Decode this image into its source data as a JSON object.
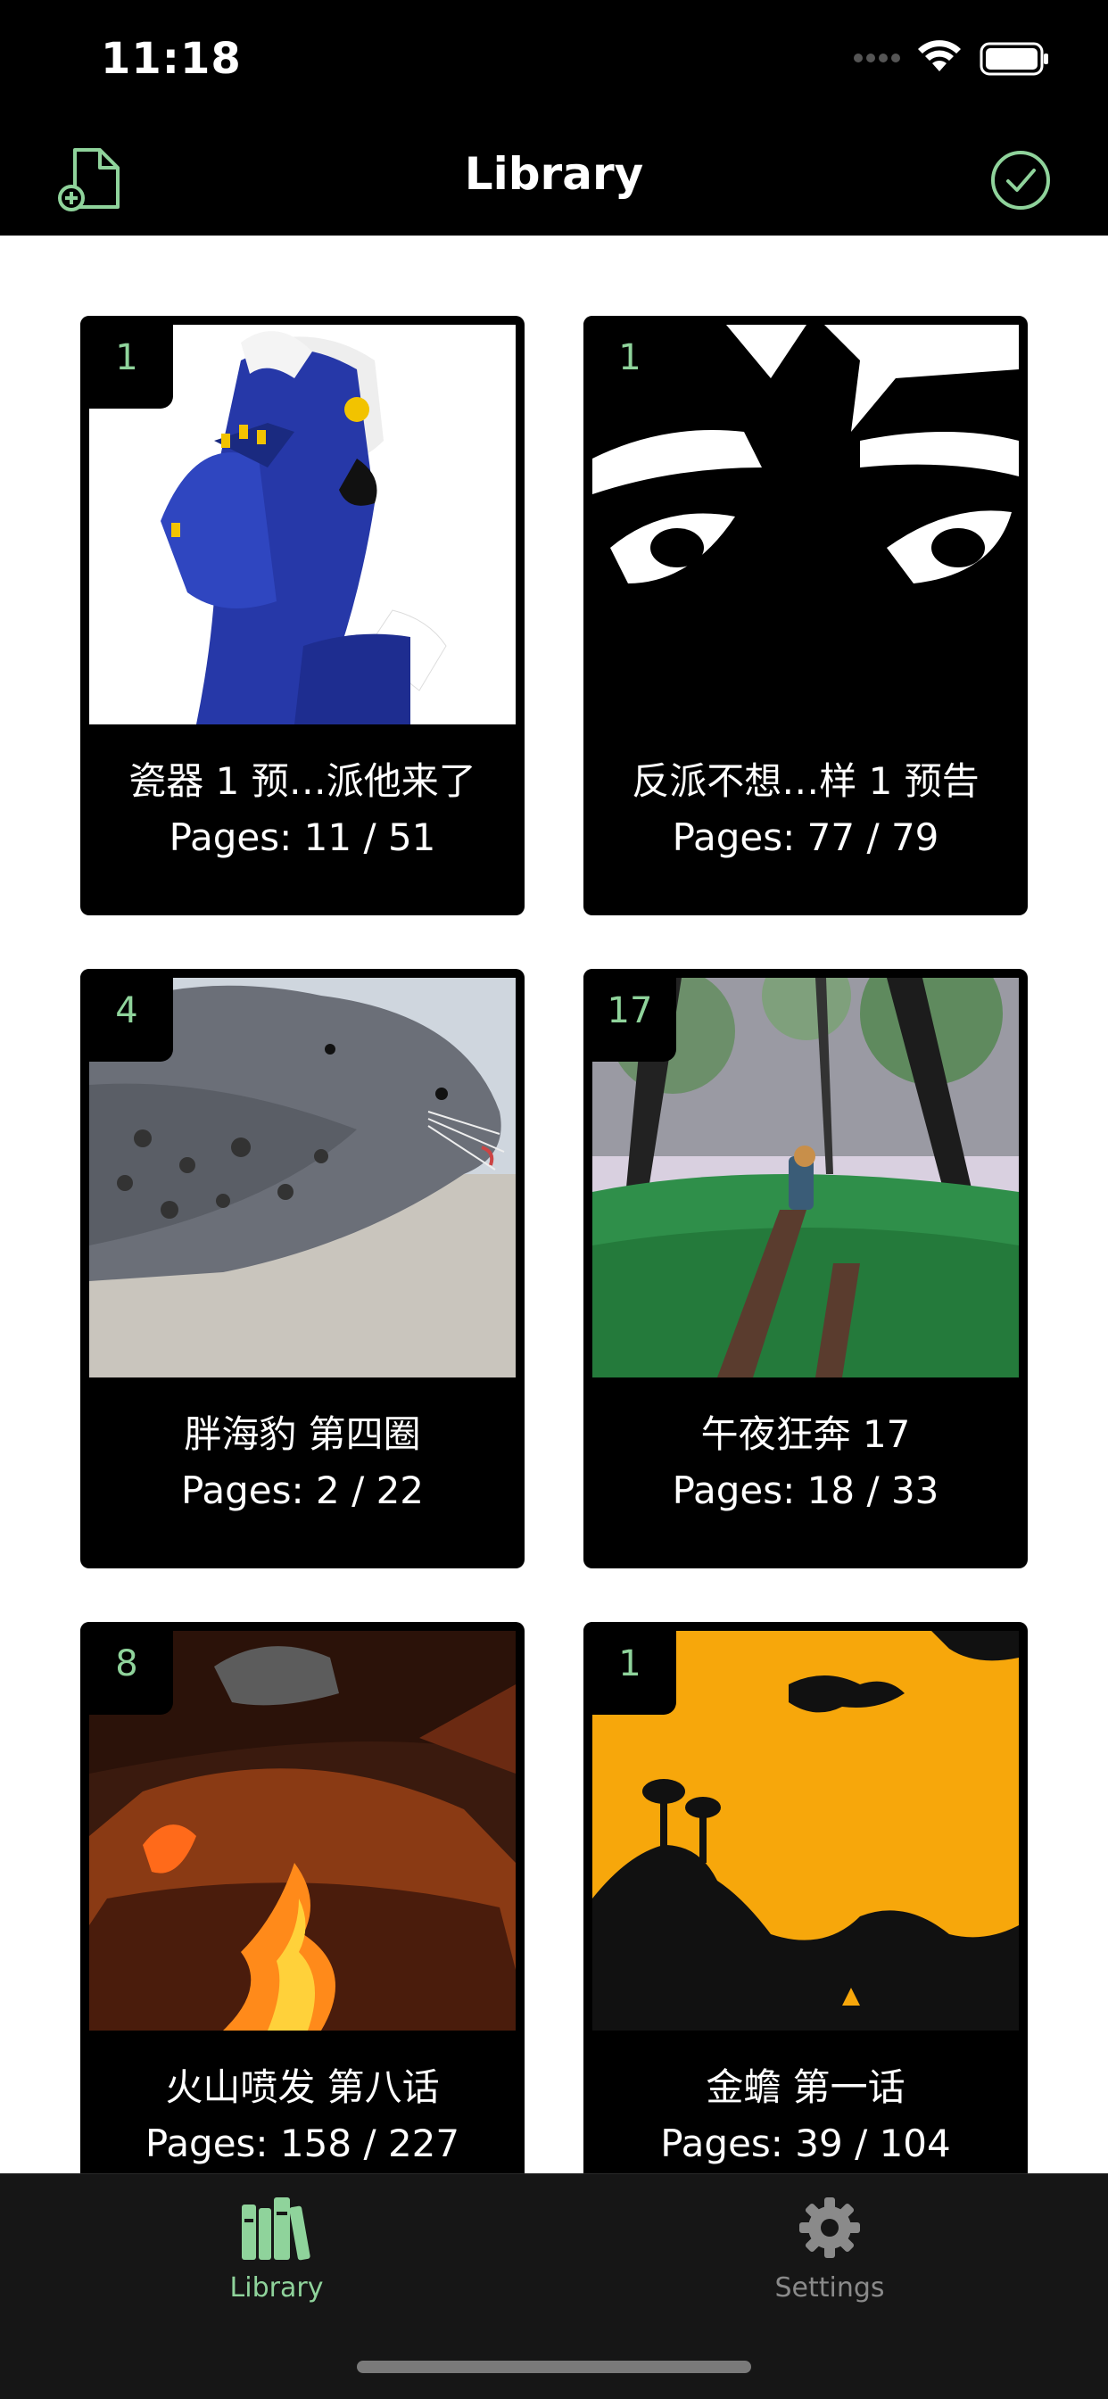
{
  "status_bar": {
    "time": "11:18"
  },
  "nav": {
    "title": "Library",
    "add_icon": "add-document-icon",
    "select_icon": "checkmark-circle-icon"
  },
  "colors": {
    "accent": "#8fd39b",
    "background": "#ffffff",
    "bars": "#000000",
    "tab_bar": "#161616"
  },
  "library": {
    "items": [
      {
        "badge": "1",
        "title": "瓷器 1 预…派他来了",
        "pages": "Pages: 11 / 51"
      },
      {
        "badge": "1",
        "title": "反派不想…样 1 预告",
        "pages": "Pages: 77 / 79"
      },
      {
        "badge": "4",
        "title": "胖海豹 第四圈",
        "pages": "Pages: 2 / 22"
      },
      {
        "badge": "17",
        "title": "午夜狂奔 17",
        "pages": "Pages: 18 / 33"
      },
      {
        "badge": "8",
        "title": "火山喷发 第八话",
        "pages": "Pages: 158 / 227"
      },
      {
        "badge": "1",
        "title": "金蟾 第一话",
        "pages": "Pages: 39 / 104"
      }
    ]
  },
  "tab_bar": {
    "tabs": [
      {
        "label": "Library",
        "icon": "books-icon",
        "active": true
      },
      {
        "label": "Settings",
        "icon": "gear-icon",
        "active": false
      }
    ]
  }
}
